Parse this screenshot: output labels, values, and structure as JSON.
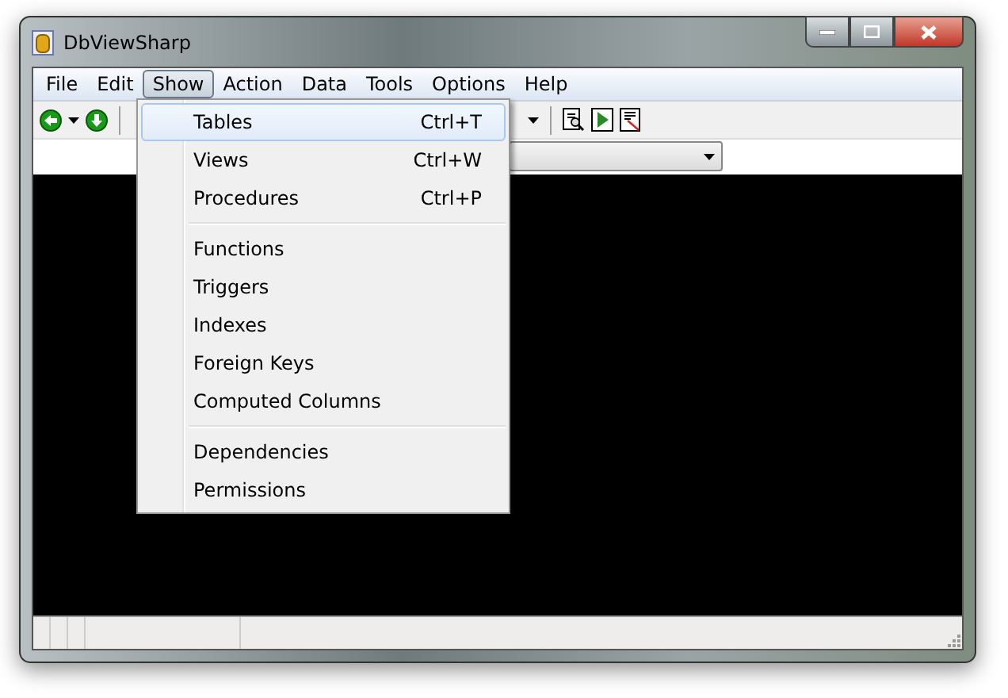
{
  "window": {
    "title": "DbViewSharp"
  },
  "menu_bar": [
    {
      "label": "File",
      "selected": false
    },
    {
      "label": "Edit",
      "selected": false
    },
    {
      "label": "Show",
      "selected": true
    },
    {
      "label": "Action",
      "selected": false
    },
    {
      "label": "Data",
      "selected": false
    },
    {
      "label": "Tools",
      "selected": false
    },
    {
      "label": "Options",
      "selected": false
    },
    {
      "label": "Help",
      "selected": false
    }
  ],
  "show_menu": {
    "groups": [
      [
        {
          "label": "Tables",
          "shortcut": "Ctrl+T",
          "selected": true
        },
        {
          "label": "Views",
          "shortcut": "Ctrl+W",
          "selected": false
        },
        {
          "label": "Procedures",
          "shortcut": "Ctrl+P",
          "selected": false
        }
      ],
      [
        {
          "label": "Functions",
          "selected": false
        },
        {
          "label": "Triggers",
          "selected": false
        },
        {
          "label": "Indexes",
          "selected": false
        },
        {
          "label": "Foreign Keys",
          "selected": false
        },
        {
          "label": "Computed Columns",
          "selected": false
        }
      ],
      [
        {
          "label": "Dependencies",
          "selected": false
        },
        {
          "label": "Permissions",
          "selected": false
        }
      ]
    ]
  }
}
